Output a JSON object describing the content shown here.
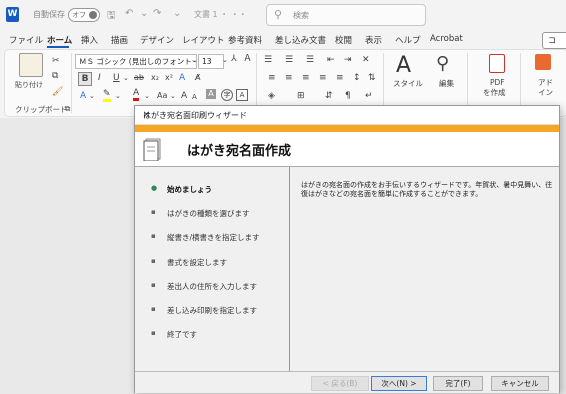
{
  "titlebar": {
    "autosave_label": "自動保存",
    "autosave_state": "オフ",
    "doc_title": "文書 1 ・ ・・",
    "search_placeholder": "検索"
  },
  "menu": [
    "ファイル",
    "ホーム",
    "挿入",
    "描画",
    "デザイン",
    "レイアウト",
    "参考資料",
    "差し込み文書",
    "校閲",
    "表示",
    "ヘルプ",
    "Acrobat"
  ],
  "comment_label": "コ",
  "ribbon": {
    "paste_label": "貼り付け",
    "clipboard_group": "クリップボード",
    "font_name": "ＭＳ ゴシック (見出しのフォント - 日",
    "font_size": "13",
    "style_label": "スタイル",
    "edit_label": "編集",
    "pdf_label1": "PDF",
    "pdf_label2": "を作成",
    "addin_label1": "アド",
    "addin_label2": "イン"
  },
  "dialog": {
    "window_title": "はがき宛名面印刷ウィザード",
    "header_title": "はがき宛名面作成",
    "steps": [
      "始めましょう",
      "はがきの種類を選びます",
      "縦書き/横書きを指定します",
      "書式を設定します",
      "差出人の住所を入力します",
      "差し込み印刷を指定します",
      "終了です"
    ],
    "description": "はがきの宛名面の作成をお手伝いするウィザードです。年賀状、暑中見舞い、往復はがきなどの宛名面を簡単に作成することができます。",
    "buttons": {
      "back": "< 戻る(B)",
      "next": "次へ(N) >",
      "finish": "完了(F)",
      "cancel": "キャンセル"
    }
  }
}
